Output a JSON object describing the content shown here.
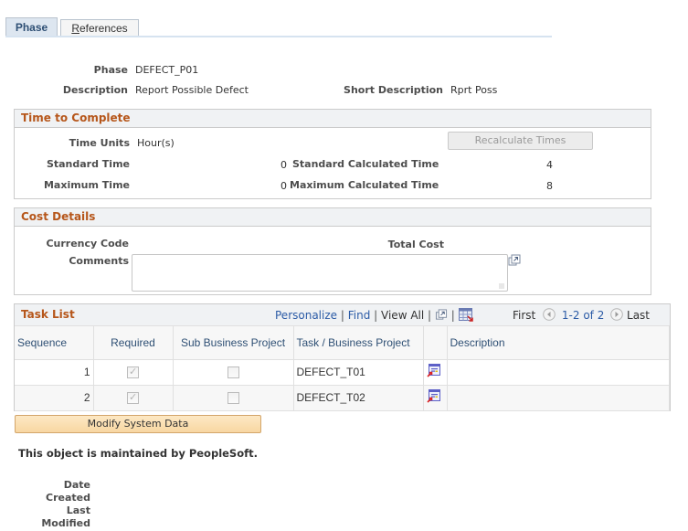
{
  "tabs": [
    {
      "label": "Phase",
      "active": true
    },
    {
      "label": "References",
      "active": false,
      "accesskey": "R",
      "rest": "eferences"
    }
  ],
  "header": {
    "phase_label": "Phase",
    "phase_value": "DEFECT_P01",
    "description_label": "Description",
    "description_value": "Report Possible Defect",
    "short_description_label": "Short Description",
    "short_description_value": "Rprt Poss"
  },
  "time_to_complete": {
    "title": "Time to Complete",
    "time_units_label": "Time Units",
    "time_units_value": "Hour(s)",
    "recalculate_button": "Recalculate Times",
    "standard_time_label": "Standard Time",
    "standard_time_value": "0",
    "standard_calc_label": "Standard Calculated Time",
    "standard_calc_value": "4",
    "maximum_time_label": "Maximum Time",
    "maximum_time_value": "0",
    "maximum_calc_label": "Maximum Calculated Time",
    "maximum_calc_value": "8"
  },
  "cost_details": {
    "title": "Cost Details",
    "currency_code_label": "Currency Code",
    "total_cost_label": "Total Cost",
    "comments_label": "Comments",
    "comments_value": ""
  },
  "task_list": {
    "title": "Task List",
    "personalize": "Personalize",
    "find": "Find",
    "view_all": "View All",
    "separator": "|",
    "first": "First",
    "range": "1-2 of 2",
    "last": "Last",
    "columns": [
      "Sequence",
      "Required",
      "Sub Business Project",
      "Task / Business Project",
      "",
      "Description"
    ],
    "rows": [
      {
        "sequence": "1",
        "required": true,
        "sub_business_project": false,
        "task": "DEFECT_T01",
        "description": ""
      },
      {
        "sequence": "2",
        "required": true,
        "sub_business_project": false,
        "task": "DEFECT_T02",
        "description": ""
      }
    ]
  },
  "modify_button": "Modify System Data",
  "maintained_note": "This object is maintained by PeopleSoft.",
  "footer": {
    "date_created_label_1": "Date",
    "date_created_label_2": "Created",
    "last_modified_label_1": "Last",
    "last_modified_label_2": "Modified"
  },
  "colors": {
    "group_title": "#b6561a",
    "link": "#2b5ba6",
    "modify_button": "#f8d7a2"
  }
}
